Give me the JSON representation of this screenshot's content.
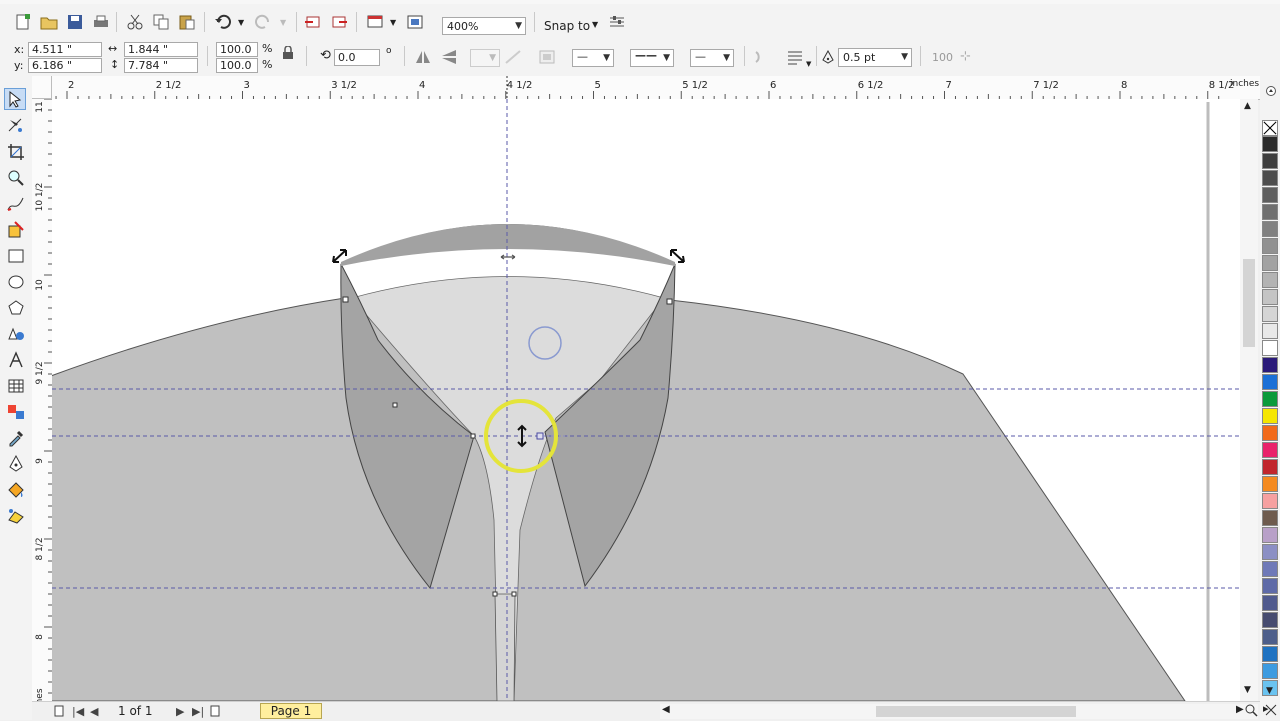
{
  "toolbar": {
    "zoom": "400%",
    "snap_to": "Snap to"
  },
  "property_bar": {
    "x_label": "x:",
    "x_value": "4.511 \"",
    "y_label": "y:",
    "y_value": "6.186 \"",
    "width_value": "1.844 \"",
    "height_value": "7.784 \"",
    "scale_x": "100.0",
    "scale_y": "100.0",
    "percent": "%",
    "rotation": "0.0",
    "degree": "o",
    "outline_width": "0.5 pt",
    "value_100": "100"
  },
  "ruler": {
    "units": "inches",
    "top_ticks": [
      "2",
      "2 1/2",
      "3",
      "3 1/2",
      "4",
      "4 1/2",
      "5",
      "5 1/2",
      "6",
      "6 1/2",
      "7",
      "7 1/2",
      "8",
      "8 1/2"
    ],
    "left_ticks": [
      "11",
      "10 1/2",
      "10",
      "9 1/2",
      "9",
      "8 1/2",
      "8",
      "inches"
    ]
  },
  "status": {
    "page_count": "1 of 1",
    "page_tab": "Page 1"
  },
  "palette": {
    "colors": [
      "#2b2b2b",
      "#3d3d3d",
      "#4d4d4d",
      "#5e5e5e",
      "#6f6f6f",
      "#808080",
      "#919191",
      "#a2a2a2",
      "#b3b3b3",
      "#c4c4c4",
      "#d5d5d5",
      "#e8e8e8",
      "#ffffff",
      "#2a1a7a",
      "#1a6fd6",
      "#0a9a3a",
      "#f5e600",
      "#f26a1b",
      "#e8216a",
      "#c1272d",
      "#f48a20",
      "#f5a0a0",
      "#6e5b4e",
      "#b8a0c8",
      "#8b8fc4",
      "#6f79b8",
      "#5e6aa8",
      "#505a8e",
      "#474c70",
      "#4d5e8a",
      "#1f72c1",
      "#3d9be0",
      "#6ac3f0"
    ]
  }
}
